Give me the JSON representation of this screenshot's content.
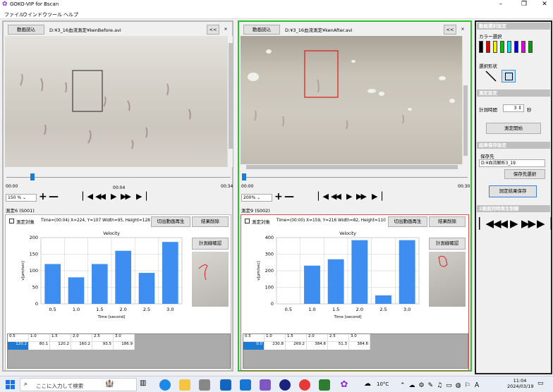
{
  "app": {
    "title": "GOKO-VIP for Bscan"
  },
  "menu": [
    "ファイル",
    "ウインドウ",
    "ツール",
    "ヘルプ"
  ],
  "left": {
    "load_btn": "動画読込",
    "path": "D:¥3_16血流測定¥kenBefore.avi",
    "collapse": "<<",
    "close": "×",
    "time_start": "00:00",
    "time_mid": "00:04",
    "time_end": "00:34",
    "zoom": "150 %",
    "section": "測定6 (S001)",
    "check_label": "測定対象",
    "info": "Time=(00:04) X=224, Y=107 Width=95, Height=128",
    "clip_btn": "切出動画再生",
    "del_btn": "結果削除",
    "confirm_btn": "計測線確認",
    "chart": {
      "title": "Velocity",
      "xlabel": "Time [second]",
      "ylabel": "v[μm/sec]",
      "yticks": [
        "0",
        "50",
        "100",
        "150",
        "200"
      ],
      "xticks": [
        "0.5",
        "1.0",
        "1.5",
        "2.0",
        "2.5",
        "3.0"
      ]
    },
    "table_head": [
      "0.5",
      "1.0",
      "1.5",
      "2.0",
      "2.5",
      "3.0"
    ],
    "table_vals": [
      "120.2",
      "80.1",
      "120.2",
      "160.2",
      "93.5",
      "186.9"
    ],
    "progress": 0.117
  },
  "right": {
    "load_btn": "動画読込",
    "path": "D:¥3_16血流測定¥kenAfter.avi",
    "collapse": "<<",
    "close": "×",
    "time_start": "00:00",
    "time_end": "00:30",
    "zoom": "200%",
    "section": "測定9 (S002)",
    "check_label": "測定対象",
    "info": "Time=(00:00) X=159, Y=216 Width=82, Height=110",
    "clip_btn": "切出動画再生",
    "del_btn": "結果削除",
    "confirm_btn": "計測線確認",
    "chart": {
      "title": "Velocity",
      "xlabel": "Time [second]",
      "ylabel": "v[μm/sec]",
      "yticks": [
        "0",
        "100",
        "200",
        "300",
        "400"
      ],
      "xticks": [
        "0.5",
        "1.0",
        "1.5",
        "2.0",
        "2.5",
        "3.0"
      ]
    },
    "table_head": [
      "0.5",
      "1.0",
      "1.5",
      "2.0",
      "2.5",
      "3.0"
    ],
    "table_vals": [
      "0.0",
      "230.8",
      "269.2",
      "384.6",
      "51.3",
      "384.6"
    ],
    "progress": 0.0
  },
  "side": {
    "h1": "動画選択設定",
    "color_label": "カラー選択",
    "colors": [
      "#000000",
      "#e00000",
      "#f0f000",
      "#00c000",
      "#00e0e0",
      "#0000e0",
      "#e000e0",
      "#00a000"
    ],
    "shape_label": "選択形状",
    "h2": "測定設定",
    "time_label": "計測時間",
    "time_val": "3",
    "time_unit": "秒",
    "start_btn": "測定開始",
    "h3": "結果保存設定",
    "dest_label": "保存先",
    "dest_val": "D:¥血流解析3_19",
    "dest_btn": "保存先選択",
    "save_btn": "測定結果保存",
    "h4": "2画面同時再生制御"
  },
  "taskbar": {
    "search": "ここに入力して検索",
    "weather": "10°C",
    "time": "11:04",
    "date": "2024/03/19"
  },
  "chart_data": [
    {
      "type": "bar",
      "title": "Velocity",
      "xlabel": "Time [second]",
      "ylabel": "v[μm/sec]",
      "categories": [
        "0.5",
        "1.0",
        "1.5",
        "2.0",
        "2.5",
        "3.0"
      ],
      "values": [
        120.2,
        80.1,
        120.2,
        160.2,
        93.5,
        186.9
      ],
      "ylim": [
        0,
        200
      ]
    },
    {
      "type": "bar",
      "title": "Velocity",
      "xlabel": "Time [second]",
      "ylabel": "v[μm/sec]",
      "categories": [
        "0.5",
        "1.0",
        "1.5",
        "2.0",
        "2.5",
        "3.0"
      ],
      "values": [
        0.0,
        230.8,
        269.2,
        384.6,
        51.3,
        384.6
      ],
      "ylim": [
        0,
        400
      ]
    }
  ]
}
